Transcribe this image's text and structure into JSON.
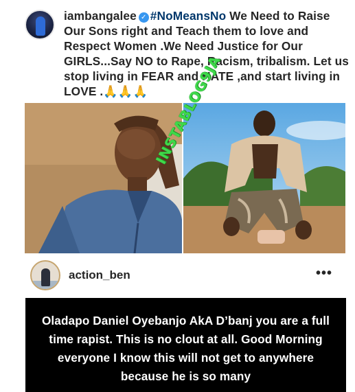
{
  "post": {
    "username": "iambangalee",
    "verified_icon": "verified-badge-icon",
    "hashtag": "#NoMeansNo",
    "caption": "We Need to Raise Our Sons right and Teach them to love and Respect Women .We Need Justice for Our GIRLS...Say NO to Rape, Racism, tribalism. Let us stop living in FEAR and HATE ,and start living in LOVE .",
    "emojis": "🙏🙏🙏"
  },
  "watermark": {
    "text": "INSTABLOG9JA",
    "color": "#3fd94a"
  },
  "comment": {
    "username": "action_ben",
    "more_icon": "more-options-icon",
    "story_text": "Oladapo Daniel Oyebanjo  AkA D’banj you are a full time rapist. This is no clout at all. Good Morning everyone I know this will not get to anywhere because he is so many"
  },
  "colors": {
    "link": "#00376b",
    "verified": "#3897f0",
    "story_bg": "#000000"
  }
}
